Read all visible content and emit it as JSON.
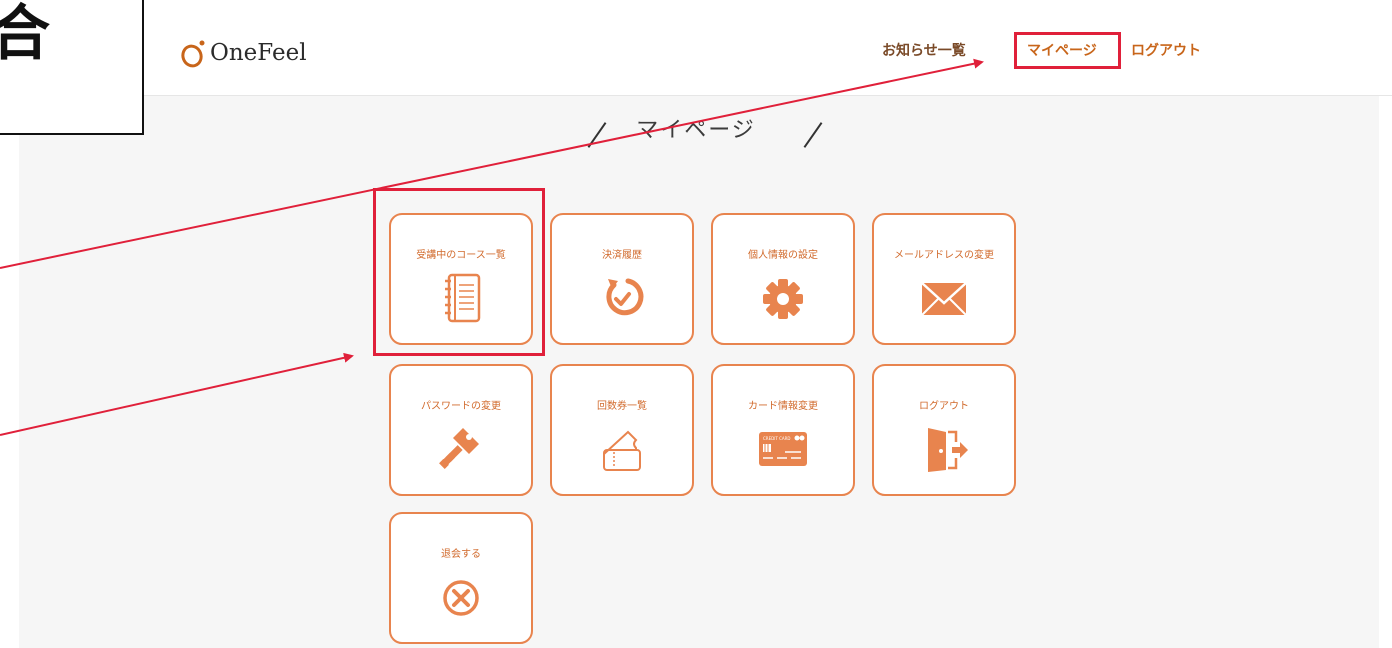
{
  "callout": {
    "text": "合"
  },
  "header": {
    "logo_text": "OneFeel",
    "nav": [
      {
        "label": "お知らせ一覧"
      },
      {
        "label": "マイページ"
      },
      {
        "label": "ログアウト"
      }
    ]
  },
  "page": {
    "title": "マイページ"
  },
  "tiles": [
    {
      "label": "受講中のコース一覧",
      "icon": "notebook-icon"
    },
    {
      "label": "決済履歴",
      "icon": "history-clock-icon"
    },
    {
      "label": "個人情報の設定",
      "icon": "gear-icon"
    },
    {
      "label": "メールアドレスの変更",
      "icon": "envelope-icon"
    },
    {
      "label": "パスワードの変更",
      "icon": "key-icon"
    },
    {
      "label": "回数券一覧",
      "icon": "ticket-icon"
    },
    {
      "label": "カード情報変更",
      "icon": "credit-card-icon"
    },
    {
      "label": "ログアウト",
      "icon": "door-exit-icon"
    },
    {
      "label": "退会する",
      "icon": "circle-x-icon"
    }
  ],
  "card_icon_text": "CREDIT CARD",
  "colors": {
    "accent": "#e8844e",
    "accent_text": "#d16a2c",
    "highlight": "#e0203a"
  }
}
